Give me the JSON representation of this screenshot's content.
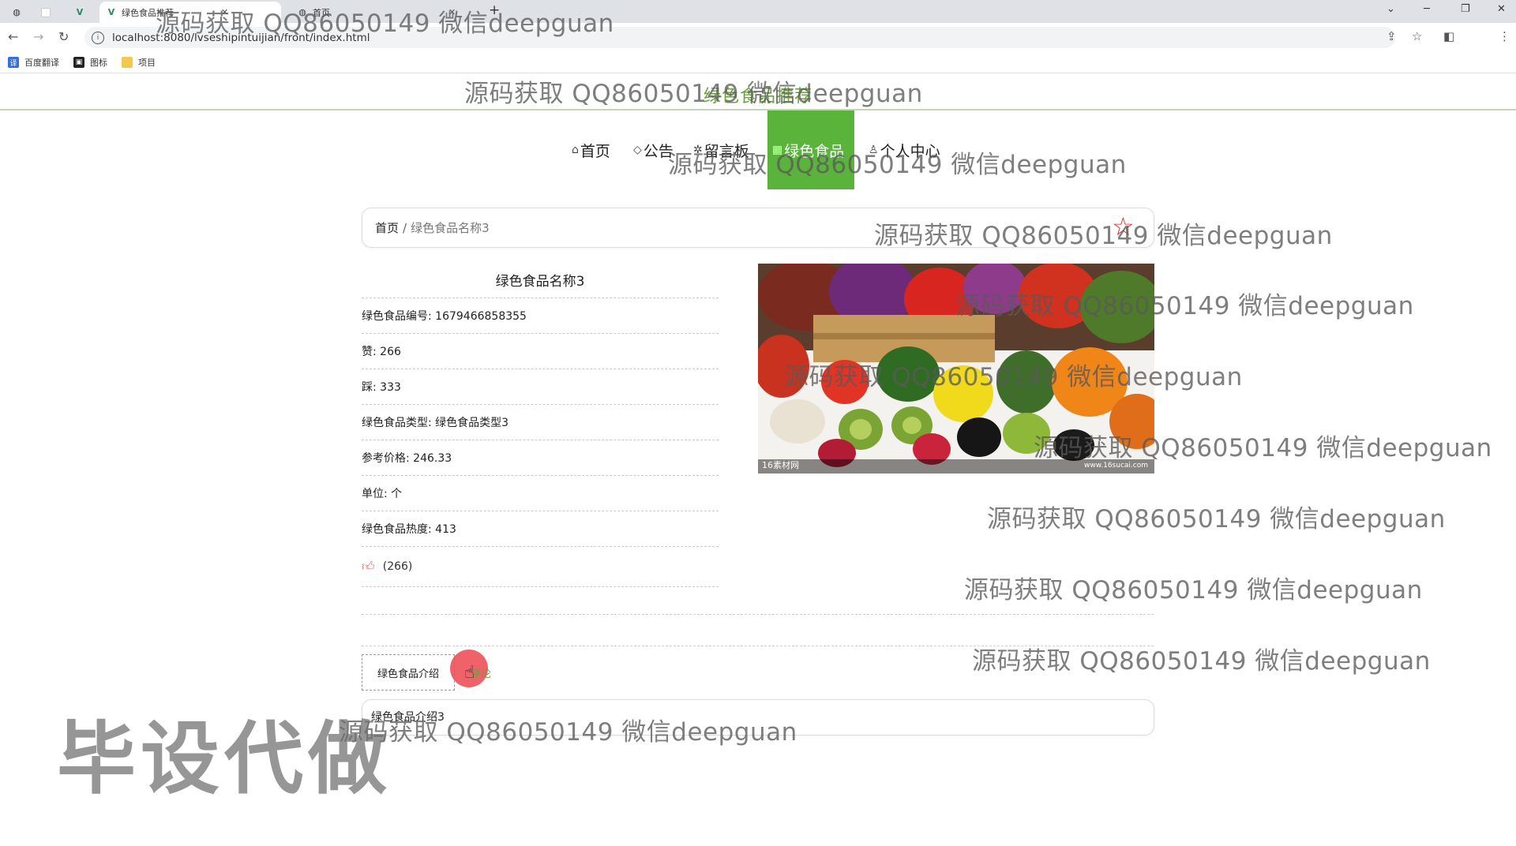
{
  "browser": {
    "tabs": [
      {
        "label": "",
        "icon": "globe-icon"
      },
      {
        "label": "",
        "icon": "blank-page-icon"
      },
      {
        "label": "",
        "icon": "vue-logo-icon"
      },
      {
        "label": "绿色食品推荐",
        "icon": "vue-logo-icon"
      },
      {
        "label": "首页",
        "icon": "globe-icon"
      }
    ],
    "url": "localhost:8080/lvseshipintuijian/front/index.html",
    "bookmarks": [
      {
        "label": "百度翻译",
        "icon": "translate-icon"
      },
      {
        "label": "图标",
        "icon": "icon-app-icon"
      },
      {
        "label": "项目",
        "icon": "folder-icon"
      }
    ]
  },
  "site": {
    "title": "绿色食品推荐",
    "nav": [
      {
        "label": "首页",
        "icon": "home-icon"
      },
      {
        "label": "公告",
        "icon": "tag-icon"
      },
      {
        "label": "留言板",
        "icon": "star-icon"
      },
      {
        "label": "绿色食品",
        "icon": "grid-icon",
        "active": true
      },
      {
        "label": "个人中心",
        "icon": "user-icon"
      }
    ],
    "accent_color": "#5ab43c"
  },
  "breadcrumb": {
    "home": "首页",
    "separator": "/",
    "current": "绿色食品名称3"
  },
  "detail": {
    "name": "绿色食品名称3",
    "rows": [
      "绿色食品编号: 1679466858355",
      "赞: 266",
      "踩: 333",
      "绿色食品类型: 绿色食品类型3",
      "参考价格: 246.33",
      "单位: 个",
      "绿色食品热度: 413"
    ],
    "like_count": "(266)",
    "image_credit_left": "16素材网",
    "image_credit_right": "www.16sucai.com"
  },
  "tabs": {
    "intro": "绿色食品介绍",
    "comment": "评论"
  },
  "content": {
    "intro_text": "绿色食品介绍3"
  },
  "watermarks": {
    "line": "源码获取 QQ86050149 微信deepguan",
    "big": "毕设代做"
  }
}
